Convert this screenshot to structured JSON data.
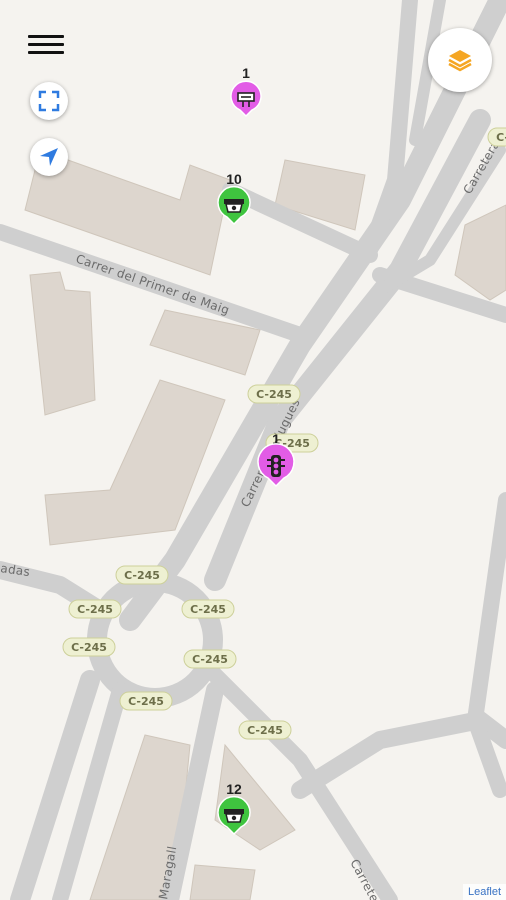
{
  "map": {
    "street_labels": {
      "primer_de_maig": "Carrer del Primer de Maig",
      "esplugues": "Carrer d'Esplugues",
      "carretera_top": "Carretera",
      "carretera_bottom": "Carretera",
      "rambladas": "adas",
      "maragall": "Maragall"
    },
    "road_shield": "C-245",
    "markers": [
      {
        "count": "1",
        "type": "billboard",
        "color": "#e25ce6",
        "icon": "billboard-icon"
      },
      {
        "count": "10",
        "type": "speed-camera",
        "color": "#3fc43f",
        "icon": "camera-icon"
      },
      {
        "count": "1",
        "type": "traffic-light",
        "color": "#e25ce6",
        "icon": "traffic-light-icon"
      },
      {
        "count": "12",
        "type": "speed-camera",
        "color": "#3fc43f",
        "icon": "camera-icon"
      }
    ]
  },
  "controls": {
    "menu_icon": "hamburger-menu-icon",
    "fullscreen_icon": "fullscreen-icon",
    "locate_icon": "navigation-arrow-icon",
    "layers_icon": "layers-icon",
    "accent": "#f5a623"
  },
  "attribution": "Leaflet"
}
